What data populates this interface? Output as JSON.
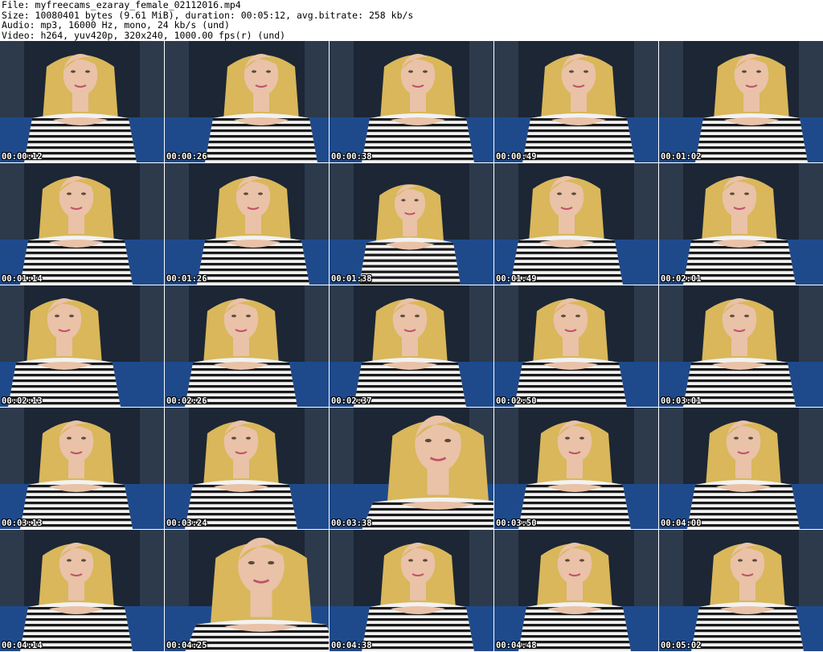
{
  "header": {
    "file": "File: myfreecams_ezaray_female_02112016.mp4",
    "size": "Size: 10080401 bytes (9.61 MiB), duration: 00:05:12, avg.bitrate: 258 kb/s",
    "audio": "Audio: mp3, 16000 Hz, mono, 24 kb/s (und)",
    "video": "Video: h264, yuv420p, 320x240, 1000.00 fps(r) (und)"
  },
  "thumbnails": [
    {
      "timestamp": "00:00:12"
    },
    {
      "timestamp": "00:00:26"
    },
    {
      "timestamp": "00:00:38"
    },
    {
      "timestamp": "00:00:49"
    },
    {
      "timestamp": "00:01:02"
    },
    {
      "timestamp": "00:01:14"
    },
    {
      "timestamp": "00:01:26"
    },
    {
      "timestamp": "00:01:38"
    },
    {
      "timestamp": "00:01:49"
    },
    {
      "timestamp": "00:02:01"
    },
    {
      "timestamp": "00:02:13"
    },
    {
      "timestamp": "00:02:26"
    },
    {
      "timestamp": "00:02:37"
    },
    {
      "timestamp": "00:02:50"
    },
    {
      "timestamp": "00:03:01"
    },
    {
      "timestamp": "00:03:13"
    },
    {
      "timestamp": "00:03:24"
    },
    {
      "timestamp": "00:03:38"
    },
    {
      "timestamp": "00:03:50"
    },
    {
      "timestamp": "00:04:00"
    },
    {
      "timestamp": "00:04:14"
    },
    {
      "timestamp": "00:04:25"
    },
    {
      "timestamp": "00:04:38"
    },
    {
      "timestamp": "00:04:48"
    },
    {
      "timestamp": "00:05:02"
    }
  ],
  "colors": {
    "background_wall": "#1c2634",
    "couch": "#1e4a8c",
    "hair": "#d9b75a",
    "skin": "#e9c2a8",
    "shirt_white": "#f2f2f2",
    "shirt_stripe": "#1a1a1a"
  }
}
